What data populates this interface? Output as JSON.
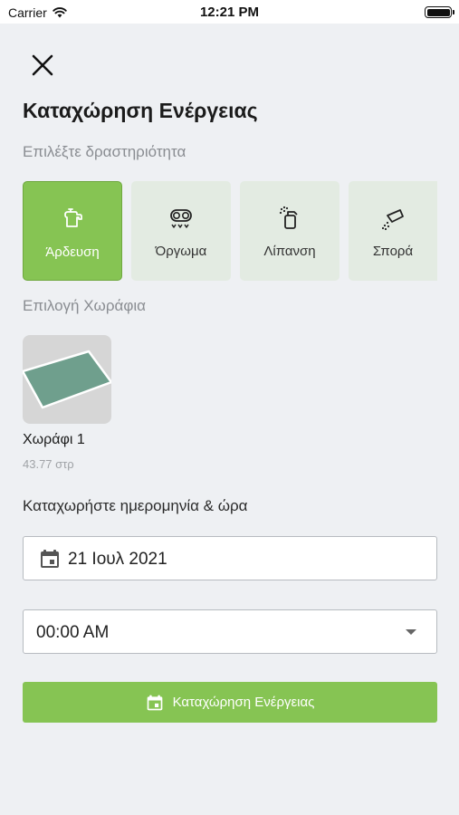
{
  "status_bar": {
    "carrier": "Carrier",
    "time": "12:21 PM",
    "wifi_icon": "wifi-icon",
    "battery_icon": "battery-icon"
  },
  "header": {
    "close_icon": "close-icon",
    "title": "Καταχώρηση Ενέργειας"
  },
  "activity": {
    "label": "Επιλέξτε δραστηριότητα",
    "selected_index": 0,
    "items": [
      {
        "label": "Άρδευση",
        "icon": "irrigation-icon",
        "selected": true
      },
      {
        "label": "Όργωμα",
        "icon": "plowing-icon",
        "selected": false
      },
      {
        "label": "Λίπανση",
        "icon": "fertilizing-icon",
        "selected": false
      },
      {
        "label": "Σπορά",
        "icon": "sowing-icon",
        "selected": false
      }
    ]
  },
  "fields": {
    "label": "Επιλογή Χωράφια",
    "items": [
      {
        "name": "Χωράφι 1",
        "area": "43.77 στρ"
      }
    ]
  },
  "datetime": {
    "label": "Καταχωρήστε ημερομηνία & ώρα",
    "date_value": "21 Ιουλ 2021",
    "date_icon": "calendar-icon",
    "time_value": "00:00 AM",
    "time_icon": "chevron-down-icon"
  },
  "submit": {
    "label": "Καταχώρηση Ενέργειας",
    "icon": "calendar-icon"
  },
  "colors": {
    "accent": "#86c453",
    "tile_inactive": "#e3ebe2",
    "background": "#eef0f3",
    "field_polygon": "#6f9f8d"
  }
}
